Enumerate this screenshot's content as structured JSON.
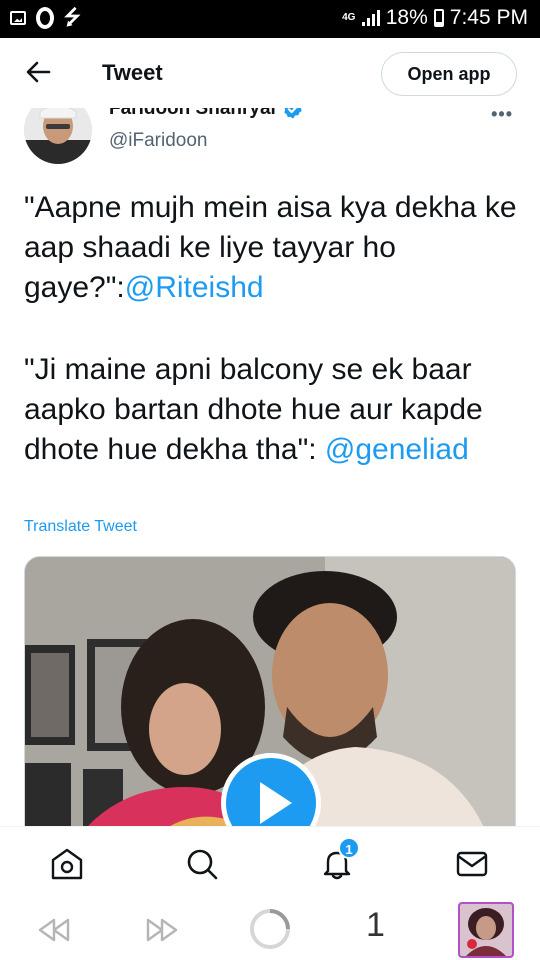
{
  "status_bar": {
    "network": "4G",
    "battery": "18%",
    "time": "7:45 PM"
  },
  "header": {
    "title": "Tweet",
    "open_app_label": "Open app"
  },
  "tweet": {
    "author_name": "Faridoon Shahryar",
    "author_handle": "@iFaridoon",
    "paragraph1_text": "\"Aapne mujh mein aisa kya dekha ke aap shaadi ke liye tayyar ho gaye?\":",
    "paragraph1_mention": "@Riteishd",
    "paragraph2_text": "\"Ji maine apni balcony se ek baar aapko bartan dhote hue aur kapde dhote hue dekha tha\": ",
    "paragraph2_mention": "@geneliad",
    "translate_label": "Translate Tweet"
  },
  "bottom_nav": {
    "notification_count": "1"
  },
  "browser_bar": {
    "tab_count": "1"
  },
  "colors": {
    "accent": "#1d9bf0",
    "text": "#0f1419",
    "secondary": "#536471"
  }
}
